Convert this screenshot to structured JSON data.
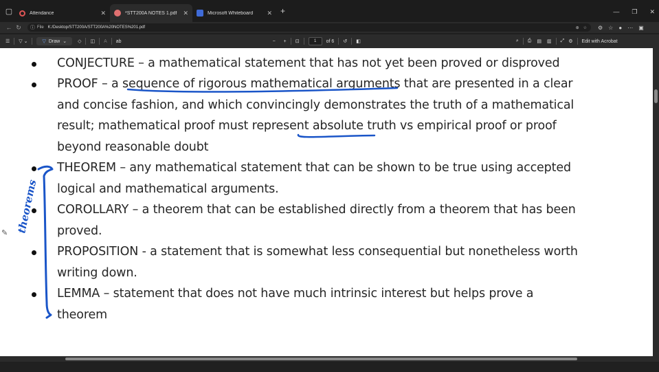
{
  "tabs": [
    {
      "title": "Attendance",
      "color": "#e05555",
      "active": false
    },
    {
      "title": "*STT200A NOTES 1.pdf",
      "color": "#e07070",
      "active": true
    },
    {
      "title": "Microsoft Whiteboard",
      "color": "#3f6bd8",
      "active": false
    }
  ],
  "address": {
    "label": "File",
    "url": "K:/Desktop/STT200A/STT200A%20NOTES%201.pdf"
  },
  "pdf_toolbar": {
    "draw_label": "Draw",
    "page_current": "1",
    "page_total": "of 6",
    "edit_label": "Edit with Acrobat"
  },
  "document": {
    "lines": [
      "CONJECTURE – a mathematical statement that has not yet been proved or disproved",
      "PROOF – a sequence of rigorous mathematical arguments that are presented in a clear",
      "and concise fashion, and which convincingly demonstrates the truth of a mathematical",
      "result; mathematical proof must represent absolute truth vs empirical proof or proof",
      "beyond reasonable doubt",
      "THEOREM – any mathematical statement that can be shown to be true using accepted",
      "logical and mathematical arguments.",
      "COROLLARY – a theorem that can be established directly from a theorem that has been",
      "proved.",
      "PROPOSITION - a statement that is somewhat less consequential but nonetheless worth",
      "writing down.",
      "LEMMA – statement that does not have much intrinsic interest but helps prove a",
      "theorem"
    ],
    "ink_annotation": "theorems",
    "ink_color": "#1a55c8"
  }
}
